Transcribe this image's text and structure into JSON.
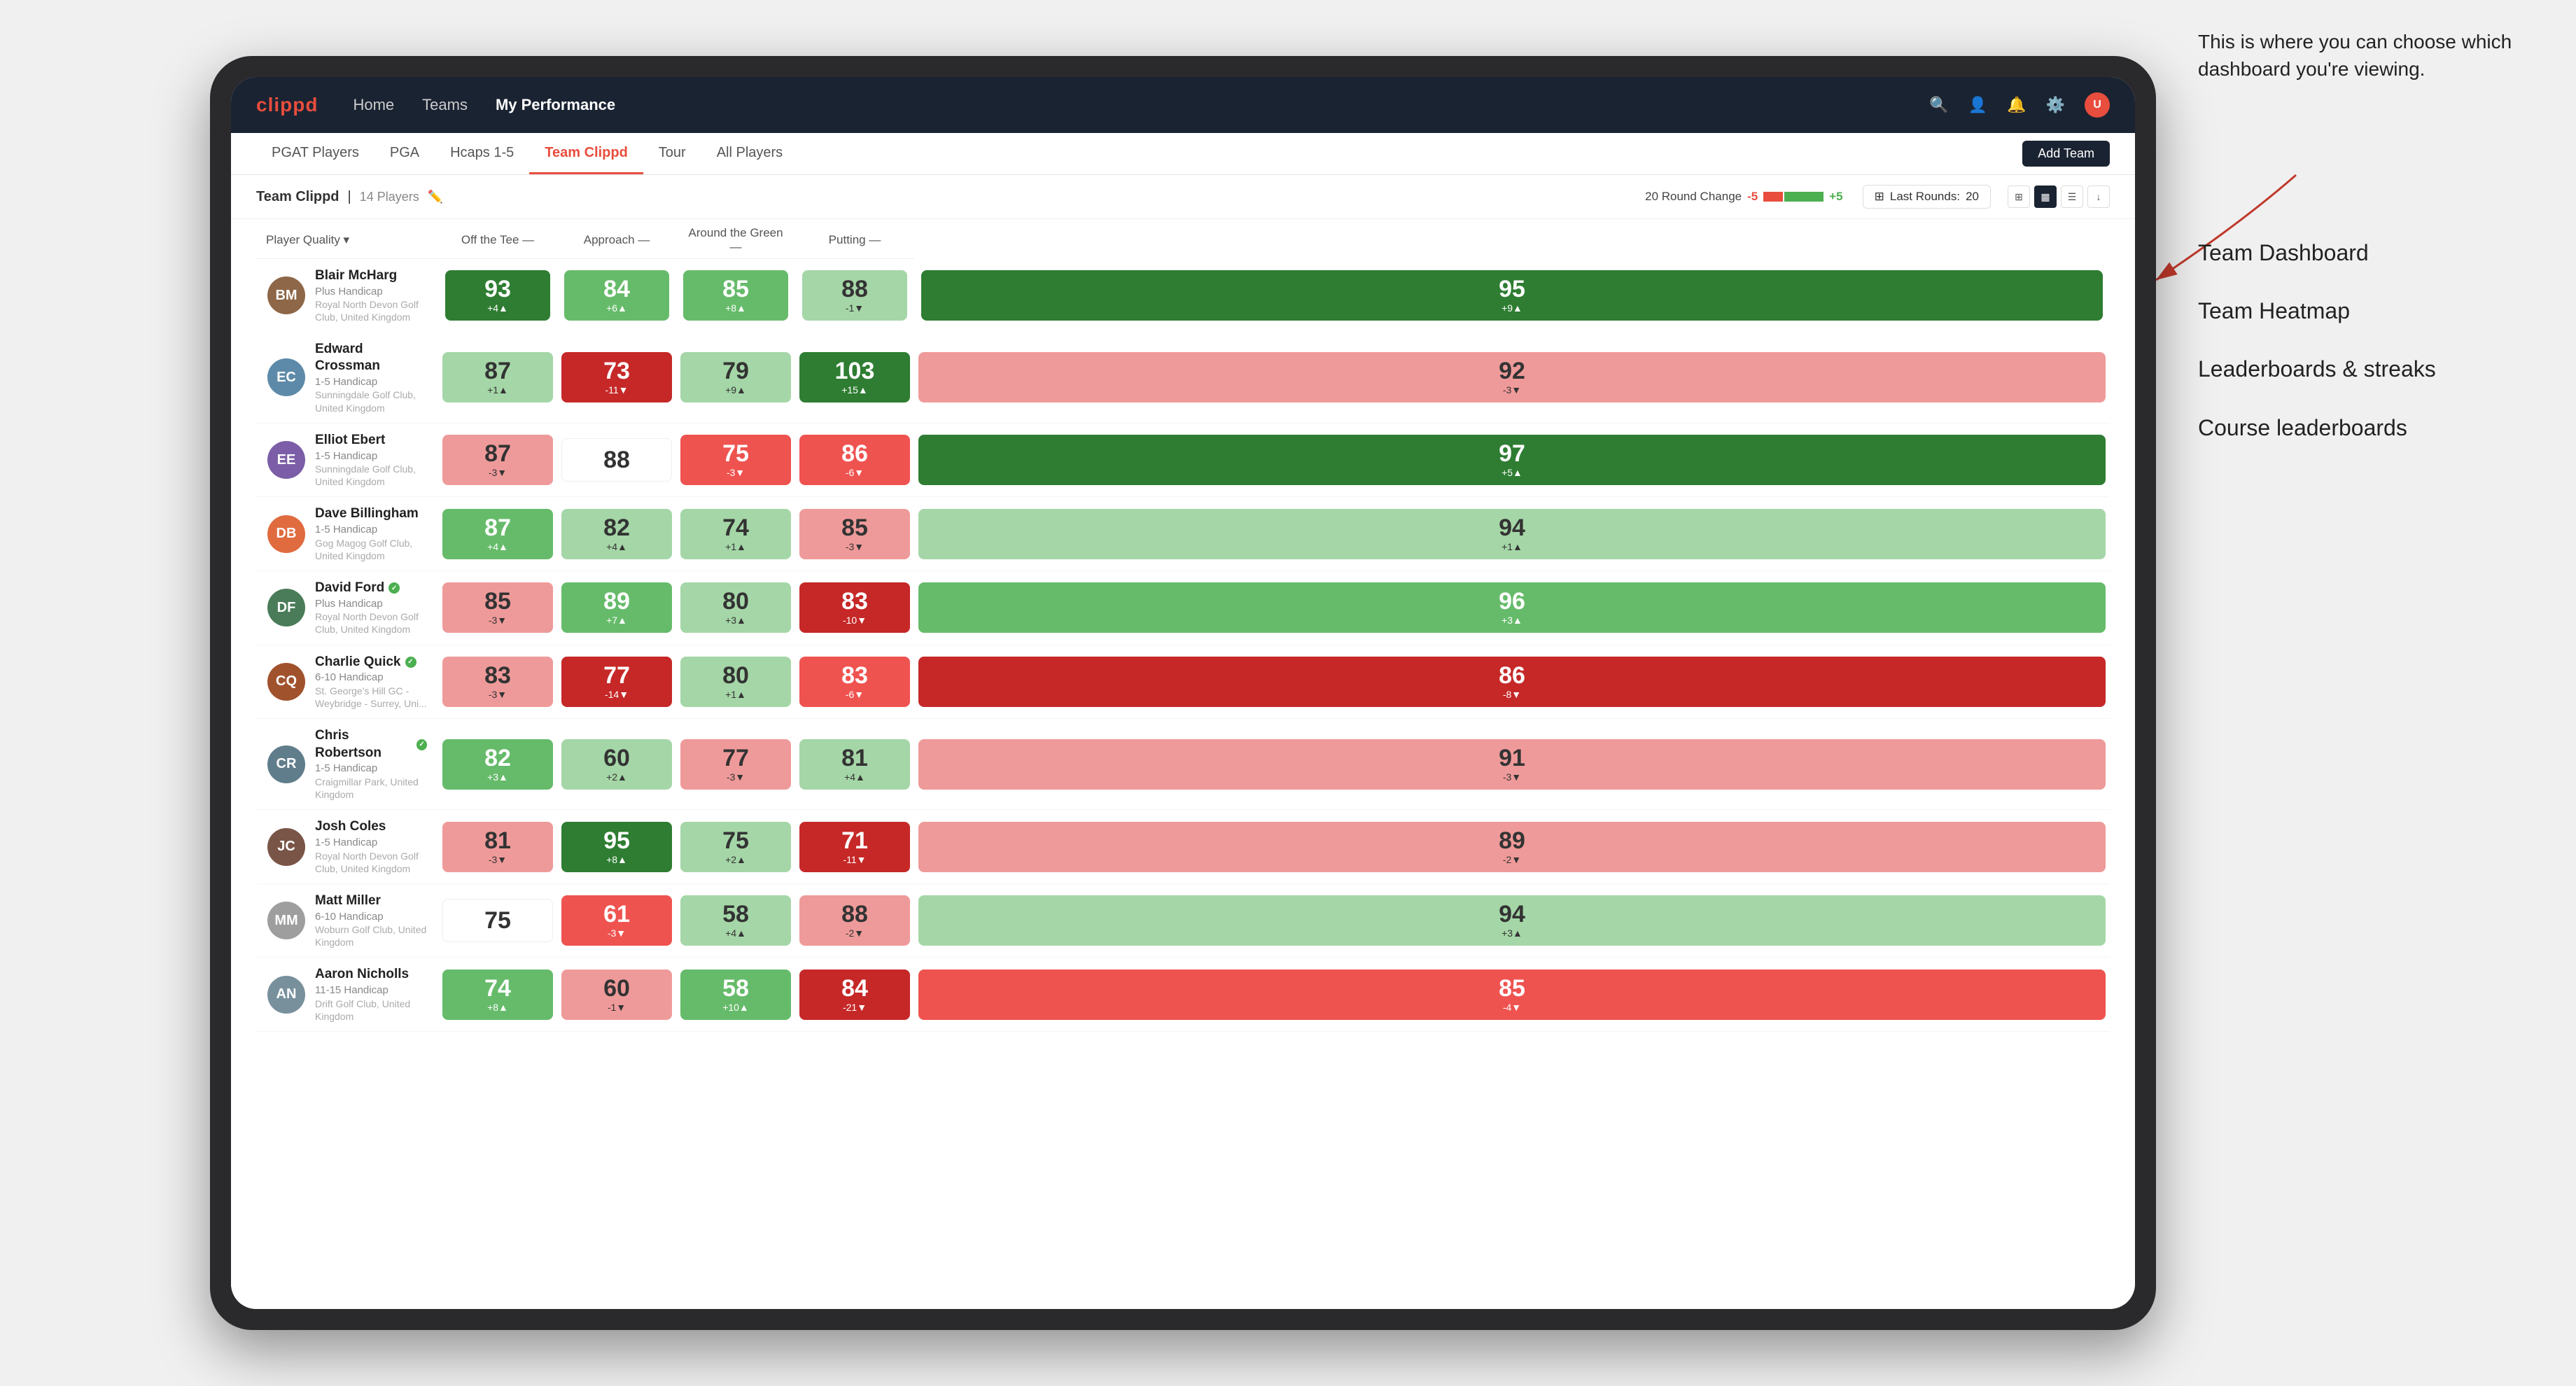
{
  "annotation": {
    "description": "This is where you can choose which dashboard you're viewing.",
    "dashboard_option_1": "Team Dashboard",
    "dashboard_option_2": "Team Heatmap",
    "dashboard_option_3": "Leaderboards & streaks",
    "dashboard_option_4": "Course leaderboards"
  },
  "nav": {
    "logo": "clippd",
    "links": [
      "Home",
      "Teams",
      "My Performance"
    ],
    "active_link": "My Performance"
  },
  "sub_nav": {
    "links": [
      "PGAT Players",
      "PGA",
      "Hcaps 1-5",
      "Team Clippd",
      "Tour",
      "All Players"
    ],
    "active_link": "Team Clippd",
    "add_team_label": "Add Team"
  },
  "team_header": {
    "title": "Team Clippd",
    "separator": "|",
    "count": "14 Players",
    "round_change_label": "20 Round Change",
    "range_neg": "-5",
    "range_pos": "+5",
    "last_rounds_label": "Last Rounds:",
    "last_rounds_value": "20"
  },
  "table": {
    "column_headers": {
      "player": "Player Quality",
      "off_tee": "Off the Tee",
      "approach": "Approach",
      "around_green": "Around the Green",
      "putting": "Putting"
    },
    "players": [
      {
        "name": "Blair McHarg",
        "handicap": "Plus Handicap",
        "club": "Royal North Devon Golf Club, United Kingdom",
        "avatar_color": "#8d6748",
        "initials": "BM",
        "scores": {
          "player_quality": {
            "value": 93,
            "change": "+4",
            "direction": "up",
            "color": "green-dark"
          },
          "off_tee": {
            "value": 84,
            "change": "+6",
            "direction": "up",
            "color": "green-mid"
          },
          "approach": {
            "value": 85,
            "change": "+8",
            "direction": "up",
            "color": "green-mid"
          },
          "around_green": {
            "value": 88,
            "change": "-1",
            "direction": "down",
            "color": "green-light"
          },
          "putting": {
            "value": 95,
            "change": "+9",
            "direction": "up",
            "color": "green-dark"
          }
        }
      },
      {
        "name": "Edward Crossman",
        "handicap": "1-5 Handicap",
        "club": "Sunningdale Golf Club, United Kingdom",
        "avatar_color": "#5d8aa8",
        "initials": "EC",
        "scores": {
          "player_quality": {
            "value": 87,
            "change": "+1",
            "direction": "up",
            "color": "green-light"
          },
          "off_tee": {
            "value": 73,
            "change": "-11",
            "direction": "down",
            "color": "red-dark"
          },
          "approach": {
            "value": 79,
            "change": "+9",
            "direction": "up",
            "color": "green-light"
          },
          "around_green": {
            "value": 103,
            "change": "+15",
            "direction": "up",
            "color": "green-dark"
          },
          "putting": {
            "value": 92,
            "change": "-3",
            "direction": "down",
            "color": "red-light"
          }
        }
      },
      {
        "name": "Elliot Ebert",
        "handicap": "1-5 Handicap",
        "club": "Sunningdale Golf Club, United Kingdom",
        "avatar_color": "#7b5ea7",
        "initials": "EE",
        "scores": {
          "player_quality": {
            "value": 87,
            "change": "-3",
            "direction": "down",
            "color": "red-light"
          },
          "off_tee": {
            "value": 88,
            "change": "",
            "direction": "none",
            "color": "white-cell"
          },
          "approach": {
            "value": 75,
            "change": "-3",
            "direction": "down",
            "color": "red-mid"
          },
          "around_green": {
            "value": 86,
            "change": "-6",
            "direction": "down",
            "color": "red-mid"
          },
          "putting": {
            "value": 97,
            "change": "+5",
            "direction": "up",
            "color": "green-dark"
          }
        }
      },
      {
        "name": "Dave Billingham",
        "handicap": "1-5 Handicap",
        "club": "Gog Magog Golf Club, United Kingdom",
        "avatar_color": "#e06b3f",
        "initials": "DB",
        "scores": {
          "player_quality": {
            "value": 87,
            "change": "+4",
            "direction": "up",
            "color": "green-mid"
          },
          "off_tee": {
            "value": 82,
            "change": "+4",
            "direction": "up",
            "color": "green-light"
          },
          "approach": {
            "value": 74,
            "change": "+1",
            "direction": "up",
            "color": "green-light"
          },
          "around_green": {
            "value": 85,
            "change": "-3",
            "direction": "down",
            "color": "red-light"
          },
          "putting": {
            "value": 94,
            "change": "+1",
            "direction": "up",
            "color": "green-light"
          }
        }
      },
      {
        "name": "David Ford",
        "handicap": "Plus Handicap",
        "club": "Royal North Devon Golf Club, United Kingdom",
        "avatar_color": "#4a7c59",
        "initials": "DF",
        "verified": true,
        "scores": {
          "player_quality": {
            "value": 85,
            "change": "-3",
            "direction": "down",
            "color": "red-light"
          },
          "off_tee": {
            "value": 89,
            "change": "+7",
            "direction": "up",
            "color": "green-mid"
          },
          "approach": {
            "value": 80,
            "change": "+3",
            "direction": "up",
            "color": "green-light"
          },
          "around_green": {
            "value": 83,
            "change": "-10",
            "direction": "down",
            "color": "red-dark"
          },
          "putting": {
            "value": 96,
            "change": "+3",
            "direction": "up",
            "color": "green-mid"
          }
        }
      },
      {
        "name": "Charlie Quick",
        "handicap": "6-10 Handicap",
        "club": "St. George's Hill GC - Weybridge - Surrey, Uni...",
        "avatar_color": "#a0522d",
        "initials": "CQ",
        "verified": true,
        "scores": {
          "player_quality": {
            "value": 83,
            "change": "-3",
            "direction": "down",
            "color": "red-light"
          },
          "off_tee": {
            "value": 77,
            "change": "-14",
            "direction": "down",
            "color": "red-dark"
          },
          "approach": {
            "value": 80,
            "change": "+1",
            "direction": "up",
            "color": "green-light"
          },
          "around_green": {
            "value": 83,
            "change": "-6",
            "direction": "down",
            "color": "red-mid"
          },
          "putting": {
            "value": 86,
            "change": "-8",
            "direction": "down",
            "color": "red-dark"
          }
        }
      },
      {
        "name": "Chris Robertson",
        "handicap": "1-5 Handicap",
        "club": "Craigmillar Park, United Kingdom",
        "avatar_color": "#607d8b",
        "initials": "CR",
        "verified": true,
        "scores": {
          "player_quality": {
            "value": 82,
            "change": "+3",
            "direction": "up",
            "color": "green-mid"
          },
          "off_tee": {
            "value": 60,
            "change": "+2",
            "direction": "up",
            "color": "green-light"
          },
          "approach": {
            "value": 77,
            "change": "-3",
            "direction": "down",
            "color": "red-light"
          },
          "around_green": {
            "value": 81,
            "change": "+4",
            "direction": "up",
            "color": "green-light"
          },
          "putting": {
            "value": 91,
            "change": "-3",
            "direction": "down",
            "color": "red-light"
          }
        }
      },
      {
        "name": "Josh Coles",
        "handicap": "1-5 Handicap",
        "club": "Royal North Devon Golf Club, United Kingdom",
        "avatar_color": "#795548",
        "initials": "JC",
        "scores": {
          "player_quality": {
            "value": 81,
            "change": "-3",
            "direction": "down",
            "color": "red-light"
          },
          "off_tee": {
            "value": 95,
            "change": "+8",
            "direction": "up",
            "color": "green-dark"
          },
          "approach": {
            "value": 75,
            "change": "+2",
            "direction": "up",
            "color": "green-light"
          },
          "around_green": {
            "value": 71,
            "change": "-11",
            "direction": "down",
            "color": "red-dark"
          },
          "putting": {
            "value": 89,
            "change": "-2",
            "direction": "down",
            "color": "red-light"
          }
        }
      },
      {
        "name": "Matt Miller",
        "handicap": "6-10 Handicap",
        "club": "Woburn Golf Club, United Kingdom",
        "avatar_color": "#9e9e9e",
        "initials": "MM",
        "scores": {
          "player_quality": {
            "value": 75,
            "change": "",
            "direction": "none",
            "color": "white-cell"
          },
          "off_tee": {
            "value": 61,
            "change": "-3",
            "direction": "down",
            "color": "red-mid"
          },
          "approach": {
            "value": 58,
            "change": "+4",
            "direction": "up",
            "color": "green-light"
          },
          "around_green": {
            "value": 88,
            "change": "-2",
            "direction": "down",
            "color": "red-light"
          },
          "putting": {
            "value": 94,
            "change": "+3",
            "direction": "up",
            "color": "green-light"
          }
        }
      },
      {
        "name": "Aaron Nicholls",
        "handicap": "11-15 Handicap",
        "club": "Drift Golf Club, United Kingdom",
        "avatar_color": "#78909c",
        "initials": "AN",
        "scores": {
          "player_quality": {
            "value": 74,
            "change": "+8",
            "direction": "up",
            "color": "green-mid"
          },
          "off_tee": {
            "value": 60,
            "change": "-1",
            "direction": "down",
            "color": "red-light"
          },
          "approach": {
            "value": 58,
            "change": "+10",
            "direction": "up",
            "color": "green-mid"
          },
          "around_green": {
            "value": 84,
            "change": "-21",
            "direction": "down",
            "color": "red-dark"
          },
          "putting": {
            "value": 85,
            "change": "-4",
            "direction": "down",
            "color": "red-mid"
          }
        }
      }
    ]
  }
}
